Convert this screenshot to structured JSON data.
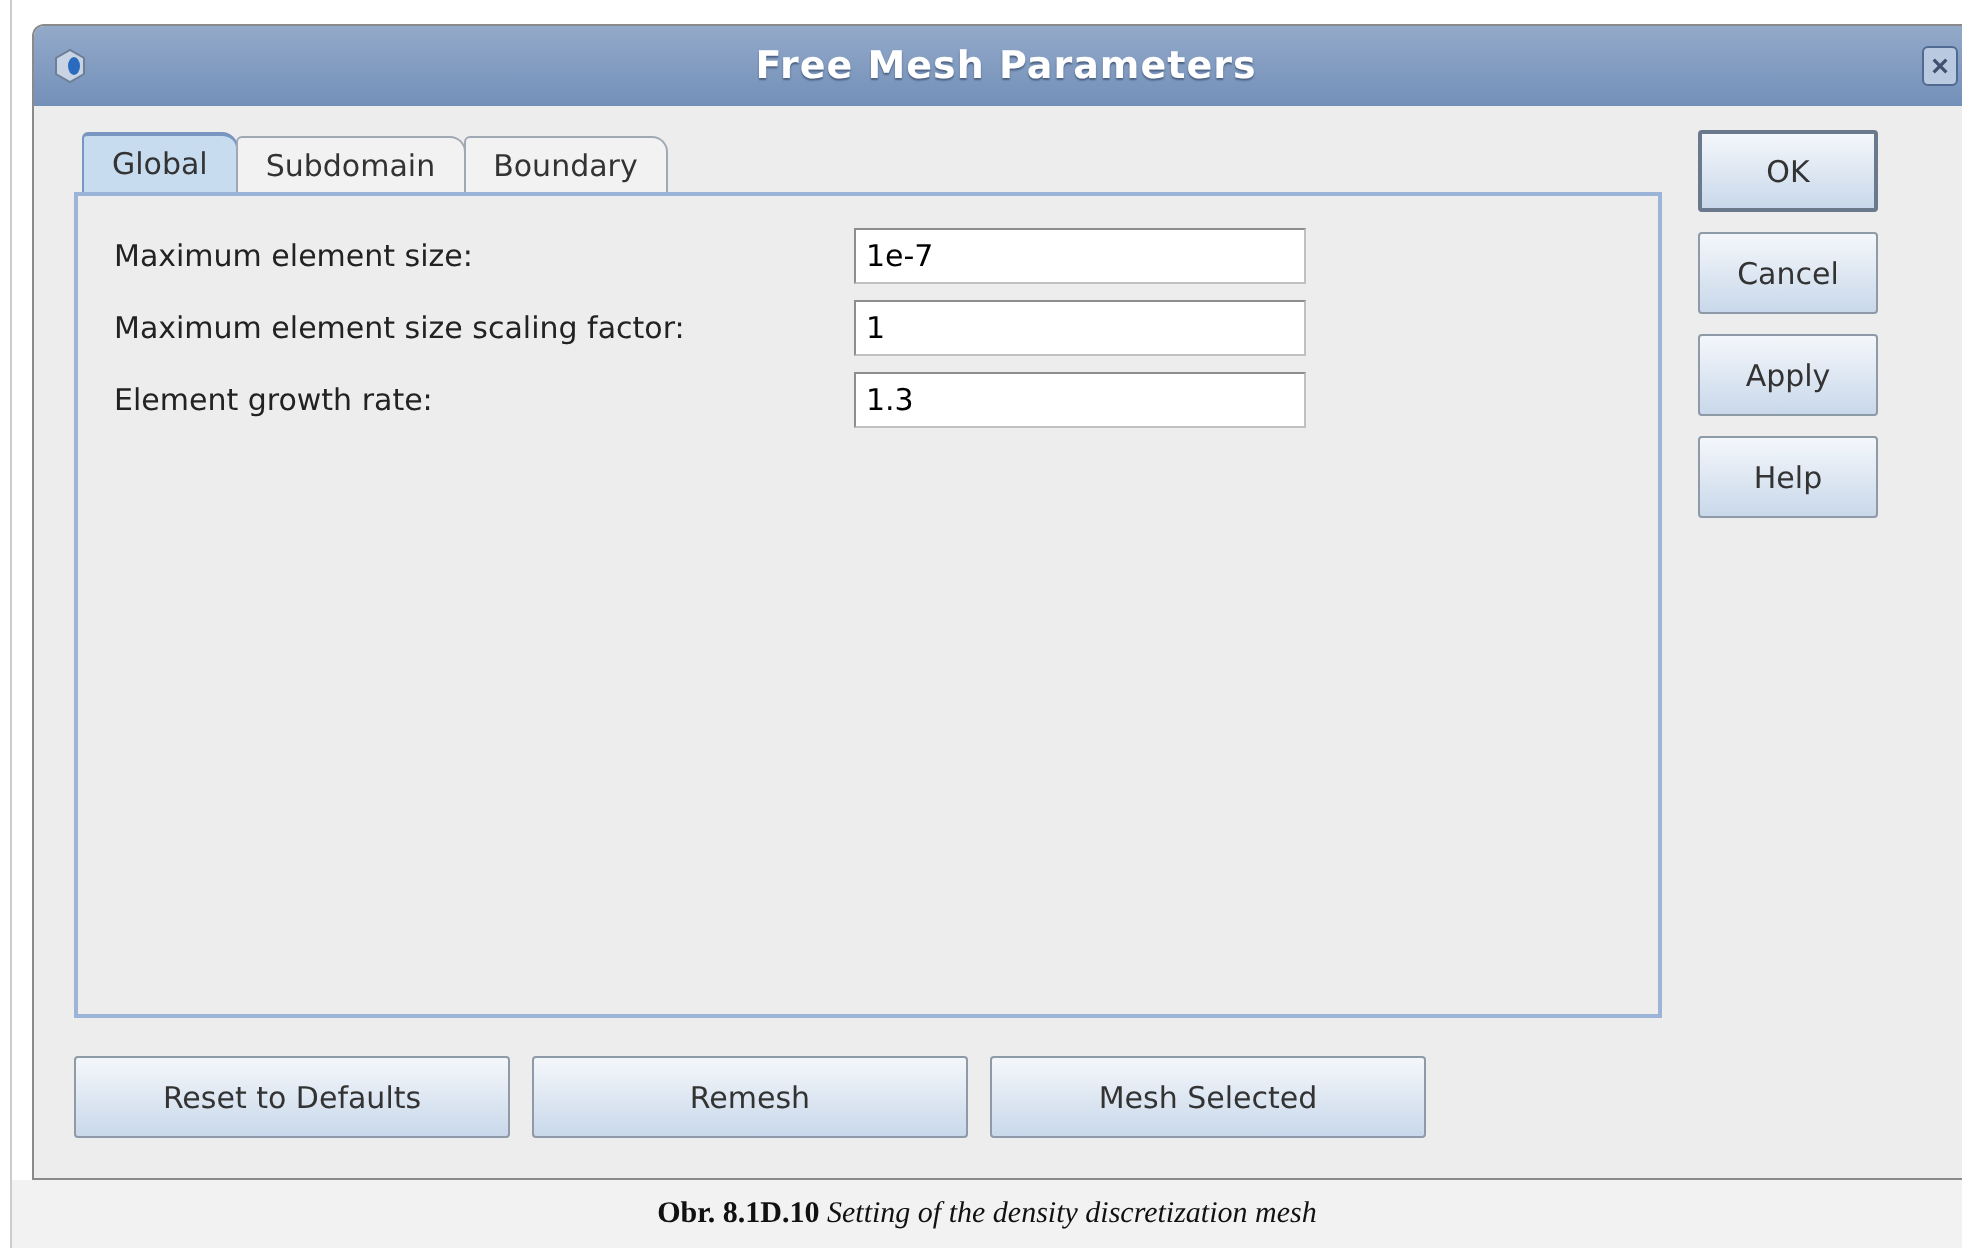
{
  "window": {
    "title": "Free Mesh Parameters",
    "close": "×"
  },
  "tabs": [
    {
      "label": "Global",
      "selected": true
    },
    {
      "label": "Subdomain",
      "selected": false
    },
    {
      "label": "Boundary",
      "selected": false
    }
  ],
  "fields": [
    {
      "label": "Maximum element size:",
      "value": "1e-7"
    },
    {
      "label": "Maximum element size scaling factor:",
      "value": "1"
    },
    {
      "label": "Element growth rate:",
      "value": "1.3"
    }
  ],
  "side_buttons": [
    {
      "label": "OK",
      "default": true
    },
    {
      "label": "Cancel",
      "default": false
    },
    {
      "label": "Apply",
      "default": false
    },
    {
      "label": "Help",
      "default": false
    }
  ],
  "bottom_buttons": [
    "Reset to Defaults",
    "Remesh",
    "Mesh Selected"
  ],
  "caption": "**Obr. 8.1D.10**   *Setting of the density discretization mesh*"
}
